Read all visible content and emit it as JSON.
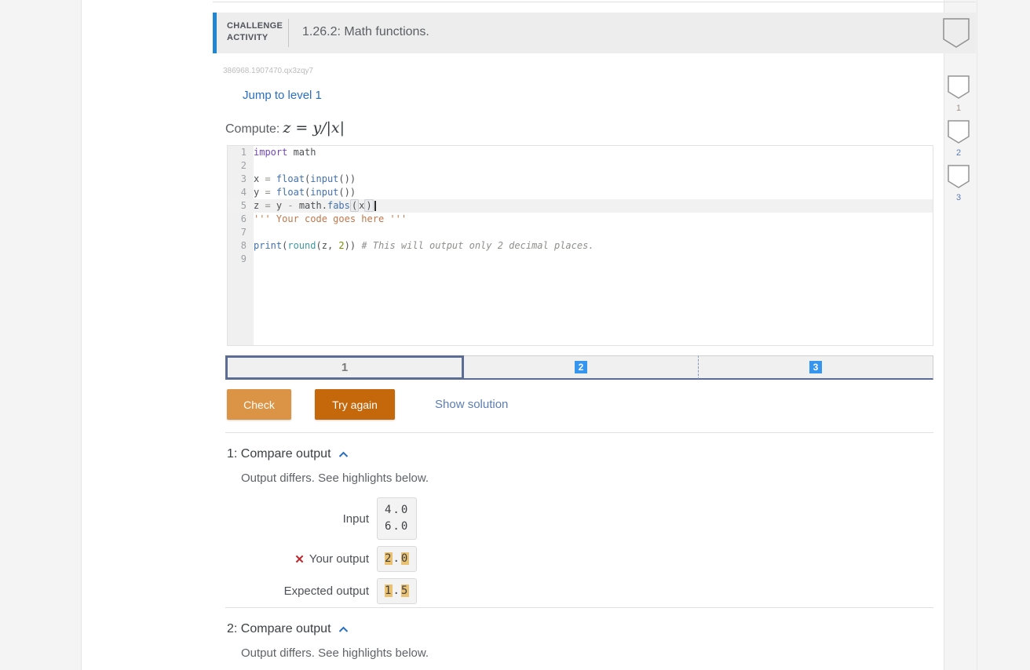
{
  "header": {
    "kicker_line1": "CHALLENGE",
    "kicker_line2": "ACTIVITY",
    "title": "1.26.2: Math functions."
  },
  "meta": {
    "activity_id": "386968.1907470.qx3zqy7",
    "jump_link": "Jump to level 1"
  },
  "prompt": {
    "label": "Compute:",
    "formula": "z = y/|x|"
  },
  "editor": {
    "lines": [
      {
        "n": "1",
        "tokens": [
          {
            "t": "import",
            "c": "kw"
          },
          {
            "t": " math",
            "c": "pl"
          }
        ]
      },
      {
        "n": "2",
        "tokens": []
      },
      {
        "n": "3",
        "tokens": [
          {
            "t": "x ",
            "c": "pl"
          },
          {
            "t": "=",
            "c": "op"
          },
          {
            "t": " ",
            "c": "pl"
          },
          {
            "t": "float",
            "c": "fn"
          },
          {
            "t": "(",
            "c": "pl"
          },
          {
            "t": "input",
            "c": "fn"
          },
          {
            "t": "())",
            "c": "pl"
          }
        ]
      },
      {
        "n": "4",
        "tokens": [
          {
            "t": "y ",
            "c": "pl"
          },
          {
            "t": "=",
            "c": "op"
          },
          {
            "t": " ",
            "c": "pl"
          },
          {
            "t": "float",
            "c": "fn"
          },
          {
            "t": "(",
            "c": "pl"
          },
          {
            "t": "input",
            "c": "fn"
          },
          {
            "t": "())",
            "c": "pl"
          }
        ]
      },
      {
        "n": "5",
        "active": true,
        "tokens": [
          {
            "t": "z ",
            "c": "pl"
          },
          {
            "t": "=",
            "c": "op"
          },
          {
            "t": " y ",
            "c": "pl"
          },
          {
            "t": "-",
            "c": "op"
          },
          {
            "t": " math.",
            "c": "pl"
          },
          {
            "t": "fabs",
            "c": "fn"
          },
          {
            "t": "(",
            "c": "pl",
            "box": true
          },
          {
            "t": "x",
            "c": "pl"
          },
          {
            "t": ")",
            "c": "pl",
            "box": true
          },
          {
            "t": "",
            "c": "pl",
            "cursor": true
          }
        ]
      },
      {
        "n": "6",
        "tokens": [
          {
            "t": "''' Your code goes here '''",
            "c": "str"
          }
        ]
      },
      {
        "n": "7",
        "tokens": []
      },
      {
        "n": "8",
        "tokens": [
          {
            "t": "print",
            "c": "fn"
          },
          {
            "t": "(",
            "c": "pl"
          },
          {
            "t": "round",
            "c": "fn2"
          },
          {
            "t": "(",
            "c": "pl"
          },
          {
            "t": "z, ",
            "c": "pl"
          },
          {
            "t": "2",
            "c": "num"
          },
          {
            "t": ")) ",
            "c": "pl"
          },
          {
            "t": "# This will output only 2 decimal places.",
            "c": "com"
          }
        ]
      },
      {
        "n": "9",
        "tokens": []
      }
    ]
  },
  "progress": {
    "segments": [
      {
        "label": "1",
        "style": "selected"
      },
      {
        "label": "2",
        "style": "chip"
      },
      {
        "label": "3",
        "style": "chip"
      }
    ]
  },
  "actions": {
    "check": "Check",
    "try_again": "Try again",
    "show_solution": "Show solution"
  },
  "levels": [
    {
      "label": "1",
      "label_color": "#a0908a"
    },
    {
      "label": "2",
      "label_color": "#5b7db3"
    },
    {
      "label": "3",
      "label_color": "#5b7db3"
    }
  ],
  "sections": [
    {
      "title": "1: Compare output",
      "message": "Output differs. See highlights below.",
      "rows": [
        {
          "label": "Input",
          "icon": "",
          "lines": [
            [
              {
                "t": "4.0",
                "h": false
              }
            ],
            [
              {
                "t": "6.0",
                "h": false
              }
            ]
          ]
        },
        {
          "label": "Your output",
          "icon": "incorrect",
          "lines": [
            [
              {
                "t": "2",
                "h": true
              },
              {
                "t": ".",
                "h": false
              },
              {
                "t": "0",
                "h": true
              }
            ]
          ]
        },
        {
          "label": "Expected output",
          "icon": "",
          "lines": [
            [
              {
                "t": "1",
                "h": true
              },
              {
                "t": ".",
                "h": false
              },
              {
                "t": "5",
                "h": true
              }
            ]
          ]
        }
      ]
    },
    {
      "title": "2: Compare output",
      "message": "Output differs. See highlights below.",
      "rows": []
    }
  ],
  "icons": {
    "incorrect": "✕",
    "caret": "chevron-up",
    "level_badge": "shield"
  },
  "colors": {
    "accent_blue": "#2086d2",
    "link_blue": "#2a6fc0",
    "solution_blue": "#5b7db3",
    "check_orange": "#db9445",
    "try_again_orange": "#c5670b",
    "highlight_gold": "#e9c171",
    "progress_slate": "#5b6d94",
    "chip_blue": "#3695ef"
  }
}
